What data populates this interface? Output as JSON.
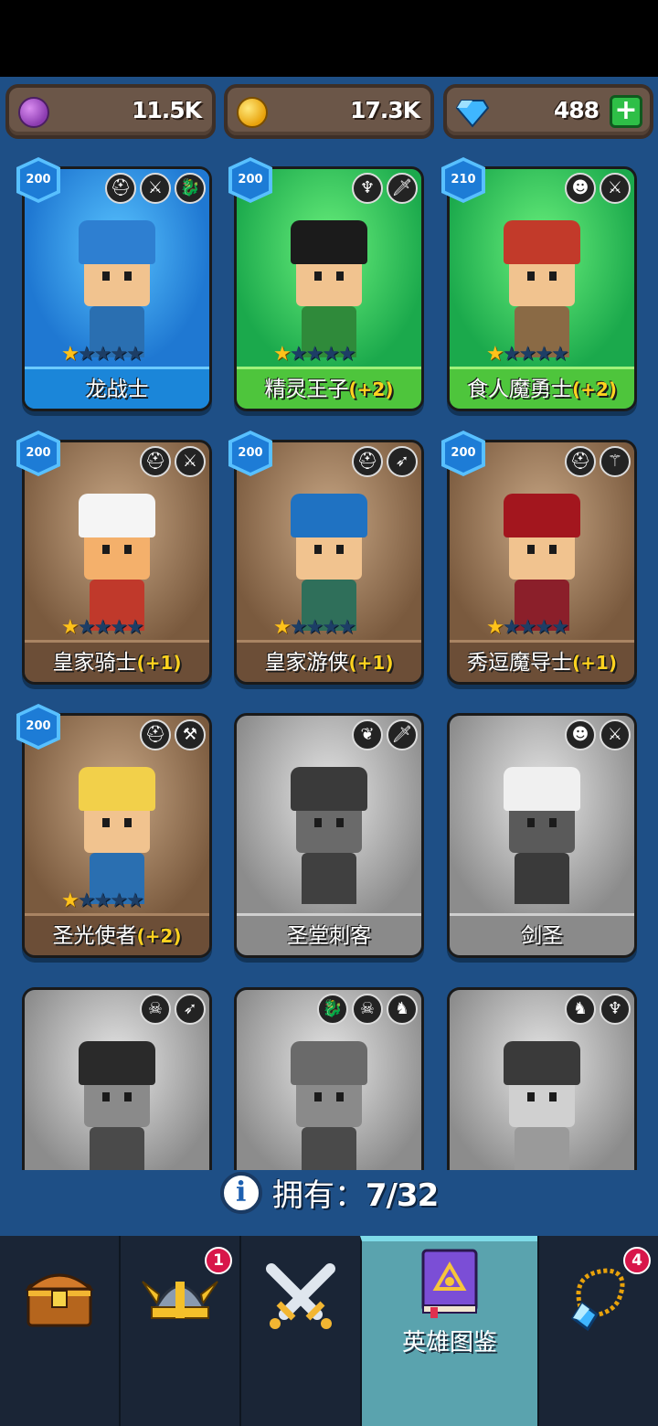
{
  "currency": {
    "purple": {
      "icon": "purple-gem-coin-icon",
      "value": "11.5K"
    },
    "gold": {
      "icon": "gold-coin-icon",
      "value": "17.3K"
    },
    "diamond": {
      "icon": "blue-diamond-icon",
      "value": "488",
      "add_label": "+"
    }
  },
  "heroes": [
    {
      "name": "龙战士",
      "bonus": "",
      "level": "200",
      "stars": 1,
      "rarity": "blue",
      "types": [
        "helmet-icon",
        "sword-icon",
        "dragon-icon"
      ]
    },
    {
      "name": "精灵王子",
      "bonus": "(+2)",
      "level": "200",
      "stars": 1,
      "rarity": "green",
      "types": [
        "elf-icon",
        "dagger-icon"
      ]
    },
    {
      "name": "食人魔勇士",
      "bonus": "(+2)",
      "level": "210",
      "stars": 1,
      "rarity": "green",
      "types": [
        "orc-icon",
        "sword-icon"
      ]
    },
    {
      "name": "皇家骑士",
      "bonus": "(+1)",
      "level": "200",
      "stars": 1,
      "rarity": "brown",
      "types": [
        "helmet-icon",
        "sword-icon"
      ]
    },
    {
      "name": "皇家游侠",
      "bonus": "(+1)",
      "level": "200",
      "stars": 1,
      "rarity": "brown",
      "types": [
        "helmet-icon",
        "bow-icon"
      ]
    },
    {
      "name": "秀逗魔导士",
      "bonus": "(+1)",
      "level": "200",
      "stars": 1,
      "rarity": "brown",
      "types": [
        "helmet-icon",
        "staff-icon"
      ]
    },
    {
      "name": "圣光使者",
      "bonus": "(+2)",
      "level": "200",
      "stars": 1,
      "rarity": "brown",
      "types": [
        "helmet-icon",
        "hammer-icon"
      ]
    },
    {
      "name": "圣堂刺客",
      "bonus": "",
      "level": "",
      "stars": 0,
      "rarity": "gray",
      "types": [
        "wings-icon",
        "dagger-icon"
      ]
    },
    {
      "name": "剑圣",
      "bonus": "",
      "level": "",
      "stars": 0,
      "rarity": "gray",
      "types": [
        "orc-icon",
        "sword-icon"
      ]
    },
    {
      "name": "",
      "bonus": "",
      "level": "",
      "stars": 0,
      "rarity": "gray",
      "types": [
        "skull-icon",
        "bow-icon"
      ]
    },
    {
      "name": "",
      "bonus": "",
      "level": "",
      "stars": 0,
      "rarity": "gray",
      "types": [
        "dragon-icon",
        "skull-icon",
        "beast-icon"
      ]
    },
    {
      "name": "",
      "bonus": "",
      "level": "",
      "stars": 0,
      "rarity": "gray",
      "types": [
        "beast-icon",
        "elf-icon"
      ]
    }
  ],
  "owned": {
    "label": "拥有：",
    "count": "7/32"
  },
  "nav": [
    {
      "icon": "treasure-chest-icon",
      "label": "",
      "badge": ""
    },
    {
      "icon": "viking-helmet-icon",
      "label": "",
      "badge": "1"
    },
    {
      "icon": "crossed-swords-icon",
      "label": "",
      "badge": ""
    },
    {
      "icon": "hero-codex-book-icon",
      "label": "英雄图鉴",
      "badge": "",
      "active": true
    },
    {
      "icon": "amulet-necklace-icon",
      "label": "",
      "badge": "4"
    }
  ]
}
